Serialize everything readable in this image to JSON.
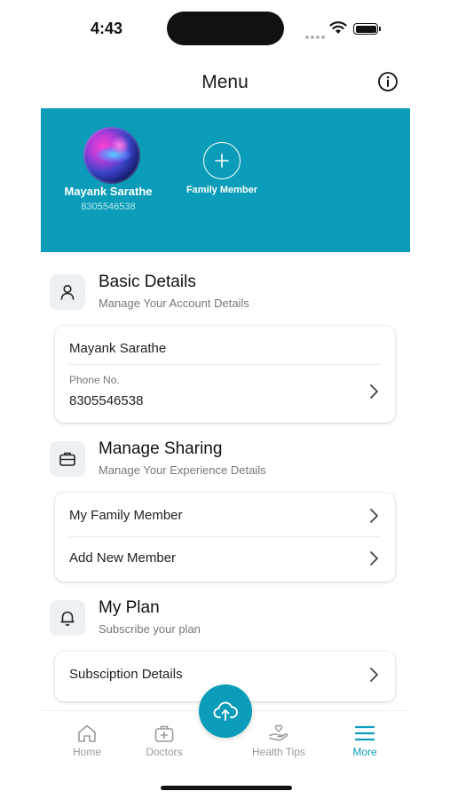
{
  "status_bar": {
    "time": "4:43"
  },
  "header": {
    "title": "Menu"
  },
  "profile": {
    "name": "Mayank Sarathe",
    "phone": "8305546538",
    "family_button_label": "Family Member"
  },
  "basic_details": {
    "title": "Basic Details",
    "subtitle": "Manage Your Account Details",
    "name_value": "Mayank Sarathe",
    "phone_label": "Phone No.",
    "phone_value": "8305546538"
  },
  "manage_sharing": {
    "title": "Manage Sharing",
    "subtitle": "Manage Your Experience Details",
    "items": [
      {
        "label": "My Family Member"
      },
      {
        "label": "Add New Member"
      }
    ]
  },
  "my_plan": {
    "title": "My Plan",
    "subtitle": "Subscribe your plan",
    "items": [
      {
        "label": "Subsciption Details"
      }
    ]
  },
  "tab_bar": {
    "items": [
      {
        "label": "Home",
        "icon": "home-icon",
        "active": false
      },
      {
        "label": "Doctors",
        "icon": "medical-bag-icon",
        "active": false
      },
      {
        "label": "Health Tips",
        "icon": "hand-heart-icon",
        "active": false
      },
      {
        "label": "More",
        "icon": "hamburger-menu-icon",
        "active": true
      }
    ],
    "fab_icon": "cloud-upload-icon"
  },
  "colors": {
    "accent": "#0a9cb8",
    "inactive_tab": "#9a9a9a"
  }
}
